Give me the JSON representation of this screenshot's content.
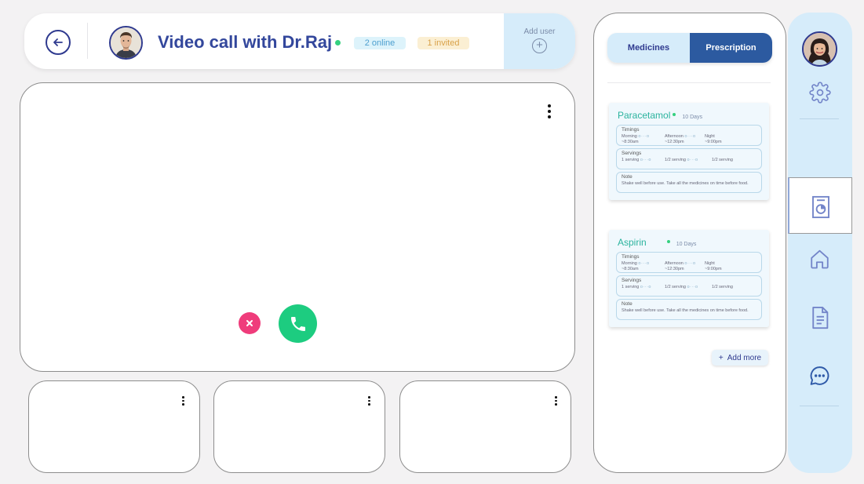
{
  "header": {
    "title": "Video call with Dr.Raj",
    "online_badge": "2 online",
    "invited_badge": "1 invited",
    "add_user_label": "Add user",
    "doctor_avatar": "doctor-avatar"
  },
  "colors": {
    "primary": "#2f3a8f",
    "accent_green": "#1dcc80",
    "end_call_pink": "#ef3c7b",
    "panel_blue": "#d6ecfa",
    "medicine_name": "#2bb39e"
  },
  "call_controls": {
    "end_icon": "close-icon",
    "accept_icon": "phone-icon"
  },
  "prescription_panel": {
    "tabs": [
      {
        "label": "Medicines",
        "active": false
      },
      {
        "label": "Prescription",
        "active": true
      }
    ],
    "medicines": [
      {
        "name": "Paracetamol",
        "duration": "10 Days",
        "timings_title": "Timings",
        "timings": [
          {
            "label": "Morning",
            "time": "~8:30am"
          },
          {
            "label": "Afternoon",
            "time": "~12:30pm"
          },
          {
            "label": "Night",
            "time": "~9:00pm"
          }
        ],
        "servings_title": "Servings",
        "servings": [
          "1 serving",
          "1/2 serving",
          "1/2 serving"
        ],
        "note_title": "Note",
        "note": "Shake well before use. Take all the medicines on time before food."
      },
      {
        "name": "Aspirin",
        "duration": "10 Days",
        "timings_title": "Timings",
        "timings": [
          {
            "label": "Morning",
            "time": "~8:30am"
          },
          {
            "label": "Afternoon",
            "time": "~12:30pm"
          },
          {
            "label": "Night",
            "time": "~9:00pm"
          }
        ],
        "servings_title": "Servings",
        "servings": [
          "1 serving",
          "1/2 serving",
          "1/2 serving"
        ],
        "note_title": "Note",
        "note": "Shake well before use. Take all the medicines on time before food."
      }
    ],
    "add_more_label": "Add more"
  },
  "nav_rail": {
    "items": [
      {
        "name": "settings",
        "icon": "gear-icon"
      },
      {
        "name": "prescription",
        "icon": "report-icon",
        "active": true
      },
      {
        "name": "home",
        "icon": "home-icon"
      },
      {
        "name": "documents",
        "icon": "document-icon"
      },
      {
        "name": "chat",
        "icon": "chat-icon"
      }
    ]
  }
}
